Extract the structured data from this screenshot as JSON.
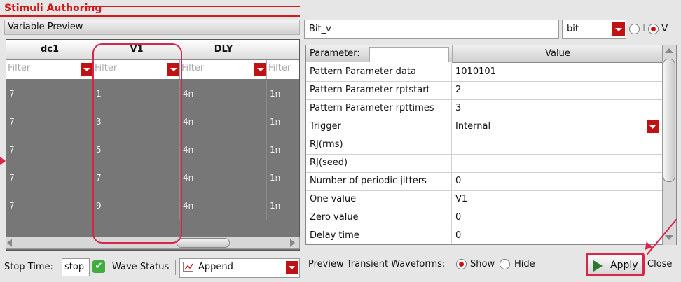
{
  "app": {
    "title": "Stimuli Authoring"
  },
  "left": {
    "section_title": "Variable Preview",
    "columns": [
      {
        "header": "dc1",
        "filter_placeholder": "Filter"
      },
      {
        "header": "V1",
        "filter_placeholder": "Filter"
      },
      {
        "header": "DLY",
        "filter_placeholder": "Filter"
      },
      {
        "header": "",
        "filter_placeholder": "Filter"
      }
    ],
    "rows": [
      [
        "7",
        "1",
        "4n",
        "1n"
      ],
      [
        "7",
        "3",
        "4n",
        "1n"
      ],
      [
        "7",
        "5",
        "4n",
        "1n"
      ],
      [
        "7",
        "7",
        "4n",
        "1n"
      ],
      [
        "7",
        "9",
        "4n",
        "1n"
      ]
    ],
    "stop_time_label": "Stop Time:",
    "stop_time_value": "stop",
    "wave_status_label": "Wave Status",
    "append_label": "Append"
  },
  "right": {
    "name_value": "Bit_v",
    "type_select": "bit",
    "mode_options": [
      "I",
      "V"
    ],
    "mode_selected": "V",
    "param_header": "Parameter:",
    "value_header": "Value",
    "params": [
      {
        "name": "Pattern Parameter data",
        "value": "1010101"
      },
      {
        "name": "Pattern Parameter rptstart",
        "value": "2"
      },
      {
        "name": "Pattern Parameter rpttimes",
        "value": "3"
      },
      {
        "name": "Trigger",
        "value": "Internal",
        "dropdown": true
      },
      {
        "name": "RJ(rms)",
        "value": ""
      },
      {
        "name": "RJ(seed)",
        "value": ""
      },
      {
        "name": "Number of periodic jitters",
        "value": "0"
      },
      {
        "name": "One value",
        "value": "V1"
      },
      {
        "name": "Zero value",
        "value": "0"
      },
      {
        "name": "Delay time",
        "value": "0"
      }
    ],
    "preview_label": "Preview Transient Waveforms:",
    "show_label": "Show",
    "hide_label": "Hide",
    "preview_selected": "Show",
    "apply_label": "Apply",
    "close_label": "Close"
  },
  "colors": {
    "accent_red": "#d21a1a",
    "highlight": "#d8264a",
    "grid_bg": "#777777"
  }
}
